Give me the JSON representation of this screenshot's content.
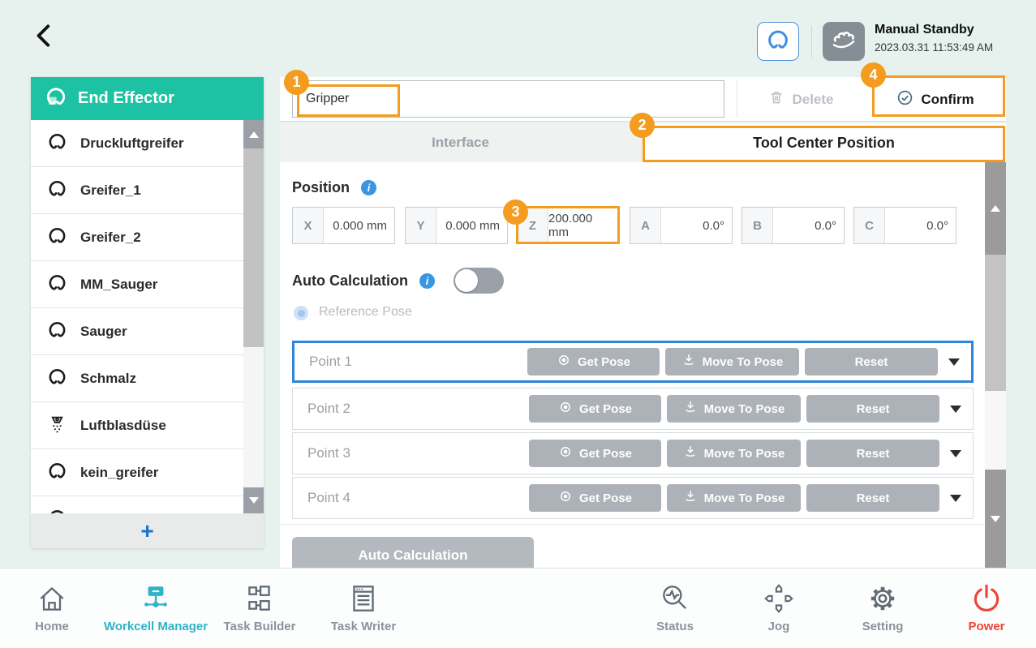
{
  "header": {
    "status_title": "Manual Standby",
    "status_time": "2023.03.31 11:53:49 AM"
  },
  "sidebar": {
    "title": "End Effector",
    "items": [
      {
        "label": "Druckluftgreifer",
        "icon": "gripper-icon"
      },
      {
        "label": "Greifer_1",
        "icon": "gripper-icon"
      },
      {
        "label": "Greifer_2",
        "icon": "gripper-icon"
      },
      {
        "label": "MM_Sauger",
        "icon": "gripper-icon"
      },
      {
        "label": "Sauger",
        "icon": "gripper-icon"
      },
      {
        "label": "Schmalz",
        "icon": "gripper-icon"
      },
      {
        "label": "Luftblasdüse",
        "icon": "air-nozzle-icon"
      },
      {
        "label": "kein_greifer",
        "icon": "gripper-icon"
      }
    ],
    "add_label": "+"
  },
  "toolbar": {
    "name_value": "Gripper",
    "delete_label": "Delete",
    "confirm_label": "Confirm"
  },
  "tabs": {
    "interface": "Interface",
    "tool_center_position": "Tool Center Position",
    "active": "Tool Center Position"
  },
  "position": {
    "title": "Position",
    "fields": [
      {
        "label": "X",
        "value": "0.000 mm"
      },
      {
        "label": "Y",
        "value": "0.000 mm"
      },
      {
        "label": "Z",
        "value": "200.000 mm"
      },
      {
        "label": "A",
        "value": "0.0°"
      },
      {
        "label": "B",
        "value": "0.0°"
      },
      {
        "label": "C",
        "value": "0.0°"
      }
    ]
  },
  "auto_calc": {
    "title": "Auto Calculation",
    "enabled": false,
    "reference_pose_label": "Reference Pose",
    "points": [
      {
        "label": "Point 1",
        "selected": true
      },
      {
        "label": "Point 2",
        "selected": false
      },
      {
        "label": "Point 3",
        "selected": false
      },
      {
        "label": "Point 4",
        "selected": false
      }
    ],
    "get_pose_label": "Get Pose",
    "move_to_pose_label": "Move To Pose",
    "reset_label": "Reset",
    "button_label": "Auto Calculation"
  },
  "nav": {
    "items": [
      {
        "label": "Home",
        "active": false
      },
      {
        "label": "Workcell Manager",
        "active": true
      },
      {
        "label": "Task Builder",
        "active": false
      },
      {
        "label": "Task Writer",
        "active": false
      },
      {
        "label": "Status",
        "active": false
      },
      {
        "label": "Jog",
        "active": false
      },
      {
        "label": "Setting",
        "active": false
      },
      {
        "label": "Power",
        "active": false
      }
    ]
  },
  "annotations": {
    "step1": "1",
    "step2": "2",
    "step3": "3",
    "step4": "4"
  },
  "colors": {
    "accent_teal": "#1cc2a3",
    "nav_active_cyan": "#2fb3c7",
    "annotation_orange": "#f39c1f",
    "selected_row_blue": "#2e86d8",
    "power_red": "#ef4337",
    "info_blue": "#3a96e0"
  }
}
